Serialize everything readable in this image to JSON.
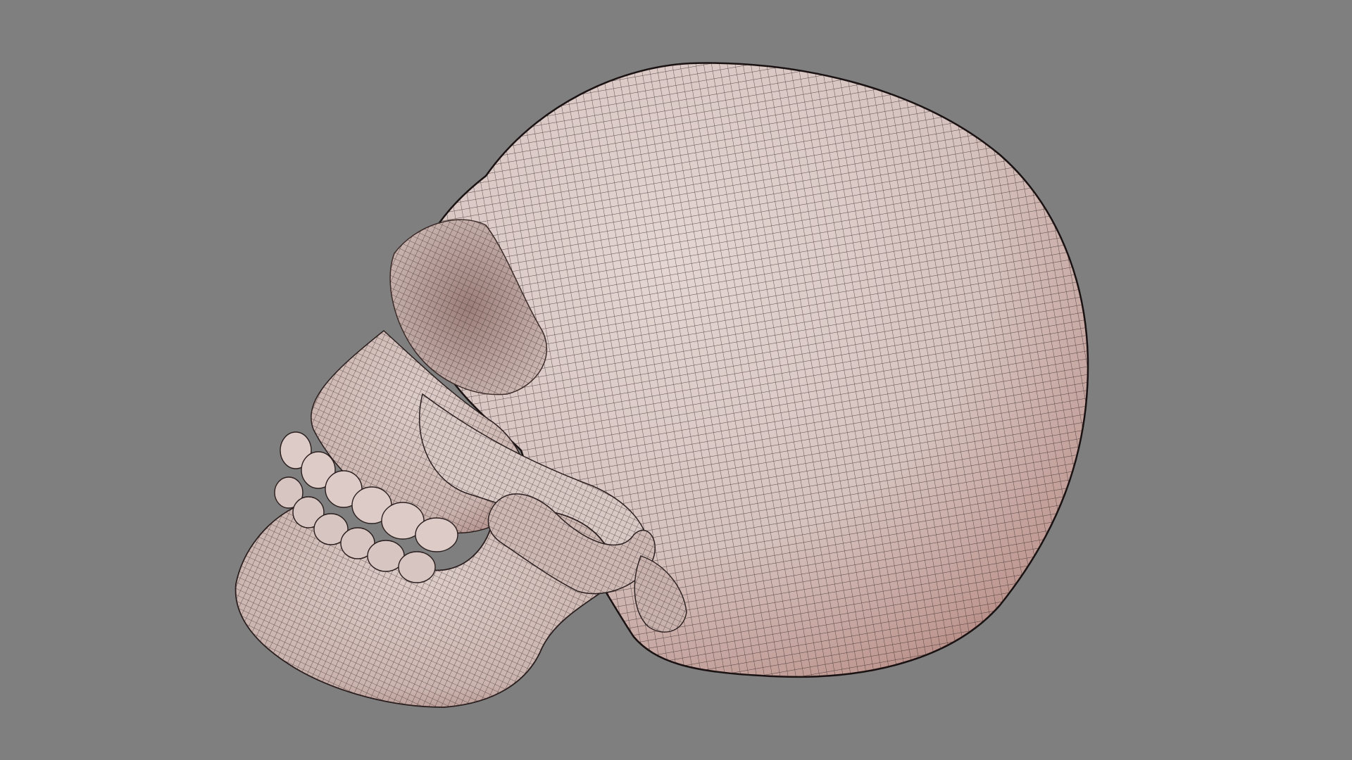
{
  "scene": {
    "subject": "skull",
    "background_color": "#7f7f7f",
    "surface_color": "#d8c6c2",
    "shadow_color": "#a2706a",
    "wire_color": "#2a1e1e"
  }
}
